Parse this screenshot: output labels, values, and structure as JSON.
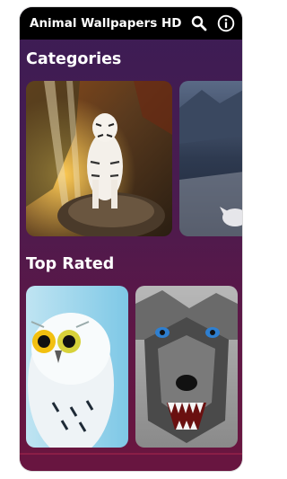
{
  "app": {
    "title": "Animal Wallpapers HD"
  },
  "toolbar": {
    "search_icon": "search-icon",
    "info_icon": "info-icon"
  },
  "sections": {
    "categories": {
      "title": "Categories"
    },
    "top_rated": {
      "title": "Top Rated"
    }
  },
  "colors": {
    "appbar": "#000000",
    "background_top": "#3b1d55",
    "background_bottom": "#6b163f",
    "text": "#ffffff"
  }
}
